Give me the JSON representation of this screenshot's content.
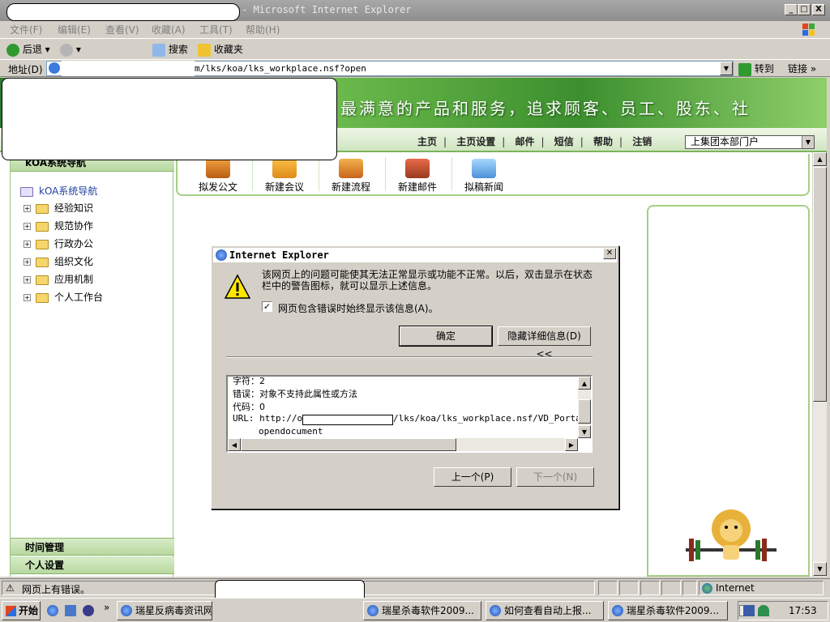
{
  "window": {
    "title_suffix": "- Microsoft Internet Explorer",
    "btn_minimize": "_",
    "btn_maximize": "□",
    "btn_close": "X"
  },
  "menu": [
    "文件(F)",
    "编辑(E)",
    "查看(V)",
    "收藏(A)",
    "工具(T)",
    "帮助(H)"
  ],
  "toolbar": {
    "back": "后退",
    "search": "搜索",
    "favorites": "收藏夹"
  },
  "address": {
    "label": "地址(D)",
    "url_visible": "m/lks/koa/lks_workplace.nsf?open",
    "go": "转到",
    "links": "链接"
  },
  "page": {
    "slogan": "最满意的产品和服务，追求顾客、员工、股东、社",
    "nav_links": [
      "主页",
      "主页设置",
      "邮件",
      "短信",
      "帮助",
      "注销"
    ],
    "portal_select": "上集团本部门户",
    "sidebar_header": "kOA系统导航",
    "tree_root": "kOA系统导航",
    "tree_items": [
      "经验知识",
      "规范协作",
      "行政办公",
      "组织文化",
      "应用机制",
      "个人工作台"
    ],
    "sidebar_footer": [
      "时间管理",
      "个人设置"
    ],
    "quick_actions": [
      "拟发公文",
      "新建会议",
      "新建流程",
      "新建邮件",
      "拟稿新闻"
    ]
  },
  "dialog": {
    "title": "Internet Explorer",
    "message": "该网页上的问题可能使其无法正常显示或功能不正常。以后，双击显示在状态栏中的警告图标，就可以显示上述信息。",
    "checkbox_label": "网页包含错误时始终显示该信息(A)。",
    "checkbox_checked": true,
    "ok_button": "确定",
    "hide_details_button": "隐藏详细信息(D) <<",
    "details": {
      "line_char": "字符：2",
      "line_error": "错误：对象不支持此属性或方法",
      "line_code": "代码：0",
      "url_prefix": "URL:  http://oa",
      "url_suffix": "/lks/koa/lks_workplace.nsf/VD_PortalPa",
      "url_cont": "opendocument"
    },
    "prev_button": "上一个(P)",
    "next_button": "下一个(N)"
  },
  "statusbar": {
    "message": "网页上有错误。",
    "zone": "Internet"
  },
  "taskbar": {
    "start": "开始",
    "tasks": [
      "瑞星反病毒资讯网",
      "瑞星杀毒软件2009...",
      "如何查看自动上报...",
      "瑞星杀毒软件2009..."
    ],
    "clock": "17:53"
  }
}
